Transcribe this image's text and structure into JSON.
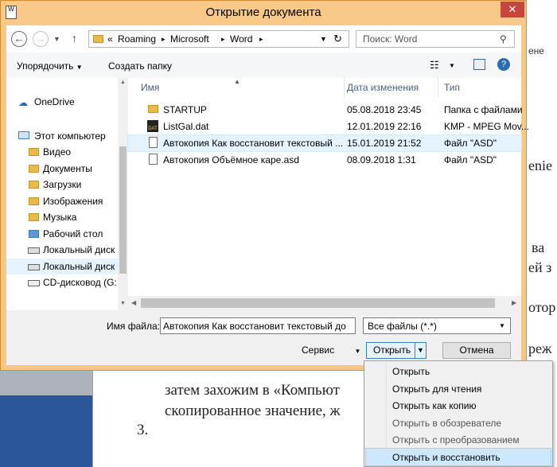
{
  "dialog": {
    "title": "Открытие документа",
    "close_glyph": "✕"
  },
  "nav": {
    "path": [
      "Roaming",
      "Microsoft",
      "Word"
    ],
    "path_prefix": "«",
    "search_placeholder": "Поиск: Word"
  },
  "commands": {
    "organize": "Упорядочить",
    "new_folder": "Создать папку"
  },
  "sidebar": {
    "items": [
      {
        "label": "OneDrive",
        "icon": "cloud-icon"
      },
      {
        "label": "Этот компьютер",
        "icon": "computer-icon"
      },
      {
        "label": "Видео",
        "icon": "video-folder-icon"
      },
      {
        "label": "Документы",
        "icon": "documents-folder-icon"
      },
      {
        "label": "Загрузки",
        "icon": "downloads-folder-icon"
      },
      {
        "label": "Изображения",
        "icon": "pictures-folder-icon"
      },
      {
        "label": "Музыка",
        "icon": "music-folder-icon"
      },
      {
        "label": "Рабочий стол",
        "icon": "desktop-folder-icon"
      },
      {
        "label": "Локальный диск",
        "icon": "drive-icon"
      },
      {
        "label": "Локальный диск",
        "icon": "drive-icon"
      },
      {
        "label": "CD-дисковод (G:",
        "icon": "cd-drive-icon"
      }
    ]
  },
  "files": {
    "columns": [
      "Имя",
      "Дата изменения",
      "Тип"
    ],
    "rows": [
      {
        "name": "STARTUP",
        "date": "05.08.2018 23:45",
        "type": "Папка с файлами",
        "icon": "folder-icon"
      },
      {
        "name": "ListGal.dat",
        "date": "12.01.2019 22:16",
        "type": "KMP - MPEG Mov...",
        "icon": "dat-file-icon"
      },
      {
        "name": "Автокопия Как восстановит текстовый ...",
        "date": "15.01.2019 21:52",
        "type": "Файл \"ASD\"",
        "icon": "file-icon"
      },
      {
        "name": "Автокопия Объёмное каре.asd",
        "date": "08.09.2018 1:31",
        "type": "Файл \"ASD\"",
        "icon": "file-icon"
      }
    ]
  },
  "bottom": {
    "filename_label": "Имя файла:",
    "filename_value": "Автокопия Как восстановит текстовый до",
    "filetype_value": "Все файлы (*.*)",
    "tools_label": "Сервис",
    "open_label": "Открыть",
    "cancel_label": "Отмена"
  },
  "open_menu": {
    "items": [
      {
        "label": "Открыть",
        "enabled": true
      },
      {
        "label": "Открыть для чтения",
        "enabled": true
      },
      {
        "label": "Открыть как копию",
        "enabled": true
      },
      {
        "label": "Открыть в обозревателе",
        "enabled": false
      },
      {
        "label": "Открыть с преобразованием",
        "enabled": false
      },
      {
        "label": "Открыть и восстановить",
        "enabled": true,
        "highlighted": true
      }
    ]
  },
  "background_doc": {
    "line1": "затем захожим в «Компьют",
    "line2": "скопированное значение, ж",
    "number": "3.",
    "side1": "enie",
    "side2": "ва",
    "side3": "ей з",
    "side4": "отор",
    "side5": "реж",
    "side_tab": "ене"
  },
  "colors": {
    "title_bar": "#f9ca87",
    "selection": "#e5f3ff",
    "close": "#c7463c",
    "word_blue": "#2b579a"
  }
}
